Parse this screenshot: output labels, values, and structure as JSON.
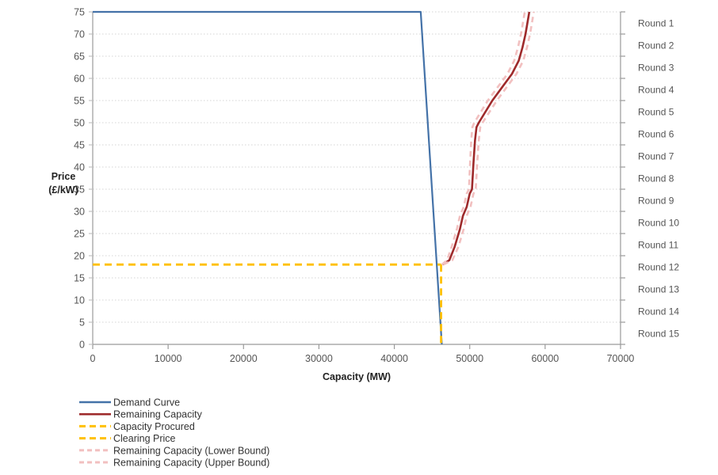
{
  "chart_data": {
    "type": "line",
    "title": "",
    "xlabel": "Capacity (MW)",
    "ylabel": "Price (£/kW)",
    "xlim": [
      0,
      70000
    ],
    "ylim": [
      0,
      75
    ],
    "xticks": [
      0,
      10000,
      20000,
      30000,
      40000,
      50000,
      60000,
      70000
    ],
    "yticks": [
      0,
      5,
      10,
      15,
      20,
      25,
      30,
      35,
      40,
      45,
      50,
      55,
      60,
      65,
      70,
      75
    ],
    "grid": true,
    "legend_position": "below-left",
    "secondary_axis": {
      "label": "",
      "categories": [
        "Round 1",
        "Round 2",
        "Round 3",
        "Round 4",
        "Round 5",
        "Round 6",
        "Round 7",
        "Round 8",
        "Round 9",
        "Round 10",
        "Round 11",
        "Round 12",
        "Round 13",
        "Round 14",
        "Round 15"
      ]
    },
    "annotations": {
      "clearing_price": 18,
      "capacity_procured": 46200
    },
    "series": [
      {
        "name": "Demand Curve",
        "color": "#4472A8",
        "style": "solid",
        "width": 2.2,
        "points": [
          [
            0,
            75
          ],
          [
            43500,
            75
          ],
          [
            46300,
            0
          ]
        ]
      },
      {
        "name": "Remaining Capacity",
        "color": "#9E2A2B",
        "style": "solid",
        "width": 2.6,
        "points": [
          [
            46400,
            18
          ],
          [
            47300,
            19
          ],
          [
            48000,
            22
          ],
          [
            48700,
            26
          ],
          [
            49100,
            29
          ],
          [
            49600,
            31
          ],
          [
            50000,
            34
          ],
          [
            50300,
            35
          ],
          [
            50500,
            41
          ],
          [
            50700,
            46
          ],
          [
            50900,
            49
          ],
          [
            51200,
            50
          ],
          [
            53000,
            55
          ],
          [
            54300,
            58
          ],
          [
            55600,
            61
          ],
          [
            56500,
            64
          ],
          [
            57000,
            67
          ],
          [
            57400,
            70
          ],
          [
            57900,
            75
          ]
        ]
      },
      {
        "name": "Capacity Procured",
        "color": "#FFC000",
        "style": "dashed",
        "width": 2.8,
        "points": [
          [
            46200,
            18
          ],
          [
            46200,
            0
          ]
        ]
      },
      {
        "name": "Clearing Price",
        "color": "#FFC000",
        "style": "dashed",
        "width": 2.8,
        "points": [
          [
            0,
            18
          ],
          [
            46200,
            18
          ]
        ]
      },
      {
        "name": "Remaining Capacity (Lower Bound)",
        "color": "#F2C0C0",
        "style": "dashed",
        "width": 2.6,
        "points": [
          [
            46300,
            18
          ],
          [
            47000,
            19
          ],
          [
            47600,
            22
          ],
          [
            48300,
            26
          ],
          [
            48700,
            29
          ],
          [
            49200,
            31
          ],
          [
            49600,
            34
          ],
          [
            49900,
            35
          ],
          [
            50050,
            41
          ],
          [
            50200,
            46
          ],
          [
            50350,
            49
          ],
          [
            50600,
            50
          ],
          [
            52400,
            55
          ],
          [
            53700,
            58
          ],
          [
            55000,
            61
          ],
          [
            55900,
            64
          ],
          [
            56400,
            67
          ],
          [
            56800,
            70
          ],
          [
            57300,
            75
          ]
        ]
      },
      {
        "name": "Remaining Capacity (Upper Bound)",
        "color": "#F2C0C0",
        "style": "dashed",
        "width": 2.6,
        "points": [
          [
            46500,
            18
          ],
          [
            47700,
            19
          ],
          [
            48500,
            22
          ],
          [
            49200,
            26
          ],
          [
            49600,
            29
          ],
          [
            50100,
            31
          ],
          [
            50500,
            34
          ],
          [
            50800,
            35
          ],
          [
            51000,
            41
          ],
          [
            51200,
            46
          ],
          [
            51400,
            49
          ],
          [
            51700,
            50
          ],
          [
            53600,
            55
          ],
          [
            54900,
            58
          ],
          [
            56200,
            61
          ],
          [
            57100,
            64
          ],
          [
            57600,
            67
          ],
          [
            58000,
            70
          ],
          [
            58500,
            75
          ]
        ]
      }
    ]
  },
  "legend": {
    "items": [
      {
        "label": "Demand Curve",
        "color": "#4472A8",
        "style": "solid"
      },
      {
        "label": "Remaining Capacity",
        "color": "#9E2A2B",
        "style": "solid"
      },
      {
        "label": "Capacity Procured",
        "color": "#FFC000",
        "style": "dashed"
      },
      {
        "label": "Clearing Price",
        "color": "#FFC000",
        "style": "dashed"
      },
      {
        "label": "Remaining Capacity (Lower Bound)",
        "color": "#F2C0C0",
        "style": "dashed"
      },
      {
        "label": "Remaining Capacity (Upper Bound)",
        "color": "#F2C0C0",
        "style": "dashed"
      }
    ]
  }
}
